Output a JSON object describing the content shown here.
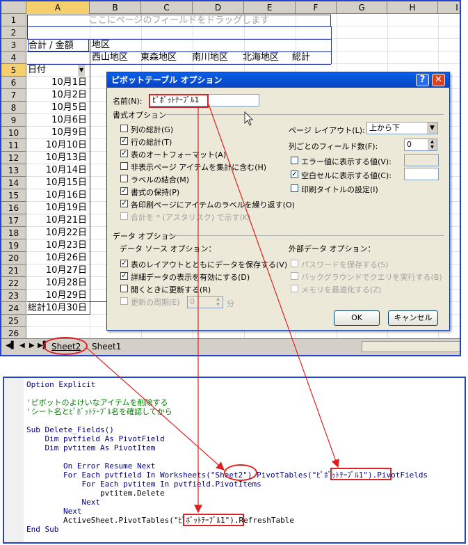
{
  "excel": {
    "columns": [
      "A",
      "B",
      "C",
      "D",
      "E",
      "F",
      "G",
      "H",
      "I"
    ],
    "rows": [
      "1",
      "2",
      "3",
      "4",
      "5",
      "6",
      "7",
      "8",
      "9",
      "10",
      "11",
      "12",
      "13",
      "14",
      "15",
      "16",
      "17",
      "18",
      "19",
      "20",
      "21",
      "22",
      "23",
      "24",
      "25",
      "26"
    ],
    "drop_zone_text": "ここにページのフィールドをドラッグします",
    "pivot_header_value": "合計 / 金額",
    "pivot_area_label": "地区",
    "row_field_label": "日付",
    "regions": [
      "西山地区",
      "東森地区",
      "南川地区",
      "北海地区",
      "総計"
    ],
    "dates": [
      "10月1日",
      "10月2日",
      "10月5日",
      "10月6日",
      "10月9日",
      "10月10日",
      "10月13日",
      "10月14日",
      "10月15日",
      "10月16日",
      "10月19日",
      "10月21日",
      "10月22日",
      "10月23日",
      "10月26日",
      "10月27日",
      "10月28日",
      "10月29日",
      "10月30日"
    ],
    "total_label": "総計",
    "sheet_tabs": [
      "Sheet2",
      "Sheet1"
    ]
  },
  "dialog": {
    "title": "ピボットテーブル オプション",
    "help_btn": "?",
    "close_btn": "✕",
    "name_label": "名前(N):",
    "name_value": "ﾋﾟﾎﾞｯﾄﾃｰﾌﾞﾙ1",
    "format_section": "書式オプション",
    "format_options": [
      {
        "label": "列の総計(G)",
        "checked": false,
        "disabled": false
      },
      {
        "label": "行の総計(T)",
        "checked": true,
        "disabled": false
      },
      {
        "label": "表のオートフォーマット(A)",
        "checked": true,
        "disabled": false
      },
      {
        "label": "非表示ページ アイテムを集計に含む(H)",
        "checked": false,
        "disabled": false
      },
      {
        "label": "ラベルの結合(M)",
        "checked": false,
        "disabled": false
      },
      {
        "label": "書式の保持(P)",
        "checked": true,
        "disabled": false
      },
      {
        "label": "各印刷ページにアイテムのラベルを繰り返す(O)",
        "checked": true,
        "disabled": false
      },
      {
        "label": "合計を * (アスタリスク) で示す(K)",
        "checked": false,
        "disabled": true
      }
    ],
    "page_layout_label": "ページ レイアウト(L):",
    "page_layout_value": "上から下",
    "fields_per_col_label": "列ごとのフィールド数(F):",
    "fields_per_col_value": "0",
    "right_options": [
      {
        "label": "エラー値に表示する値(V):",
        "checked": false
      },
      {
        "label": "空白セルに表示する値(C):",
        "checked": true
      },
      {
        "label": "印刷タイトルの設定(I)",
        "checked": false
      }
    ],
    "data_section": "データ オプション",
    "data_source_label": "データ ソース オプション：",
    "data_source_options": [
      {
        "label": "表のレイアウトとともにデータを保存する(V)",
        "checked": true,
        "disabled": false
      },
      {
        "label": "詳細データの表示を有効にする(D)",
        "checked": true,
        "disabled": false
      },
      {
        "label": "開くときに更新する(R)",
        "checked": false,
        "disabled": false
      },
      {
        "label": "更新の周期(E)",
        "checked": false,
        "disabled": true
      }
    ],
    "refresh_value": "0",
    "refresh_unit": "分",
    "external_label": "外部データ オプション：",
    "external_options": [
      {
        "label": "パスワードを保存する(S)",
        "checked": false
      },
      {
        "label": "バックグラウンドでクエリを実行する(B)",
        "checked": false
      },
      {
        "label": "メモリを最適化する(Z)",
        "checked": false
      }
    ],
    "ok_label": "OK",
    "cancel_label": "キャンセル"
  },
  "code": {
    "lines": [
      "Option Explicit",
      "",
      "'ピボットのよけいなアイテムを削除する",
      "'シート名とﾋﾟﾎﾞｯﾄﾃｰﾌﾞﾙ名を確認してから",
      "",
      "Sub Delete_Fields()",
      "    Dim pvtfield As PivotField",
      "    Dim pvtitem As PivotItem",
      "",
      "        On Error Resume Next",
      "        For Each pvtfield In Worksheets(\"Sheet2\").PivotTables(\"ﾋﾟﾎﾞｯﾄﾃｰﾌﾞﾙ1\").PivotFields",
      "            For Each pvtitem In pvtfield.PivotItems",
      "                pvtitem.Delete",
      "            Next",
      "        Next",
      "        ActiveSheet.PivotTables(\"ﾋﾟﾎﾞｯﾄﾃｰﾌﾞﾙ1\").RefreshTable",
      "End Sub"
    ]
  }
}
